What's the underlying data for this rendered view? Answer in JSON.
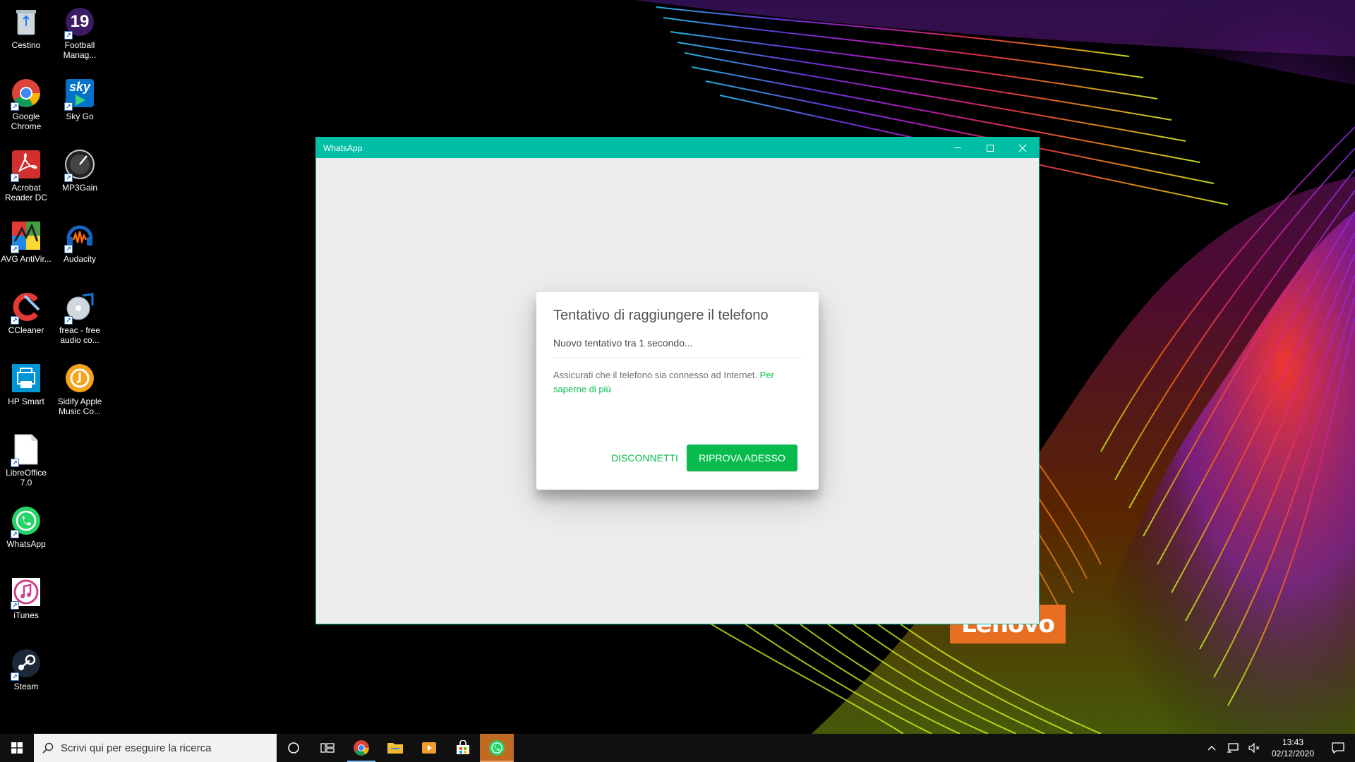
{
  "desktop": {
    "icons": [
      {
        "label": "Cestino",
        "icon": "recycle-bin-icon"
      },
      {
        "label": "Football Manag...",
        "icon": "football-manager-icon",
        "badge": "19"
      },
      {
        "label": "Google Chrome",
        "icon": "chrome-icon"
      },
      {
        "label": "Sky Go",
        "icon": "sky-go-icon",
        "badge": "sky"
      },
      {
        "label": "Acrobat Reader DC",
        "icon": "acrobat-icon"
      },
      {
        "label": "MP3Gain",
        "icon": "mp3gain-icon"
      },
      {
        "label": "AVG AntiVir...",
        "icon": "avg-icon"
      },
      {
        "label": "Audacity",
        "icon": "audacity-icon"
      },
      {
        "label": "CCleaner",
        "icon": "ccleaner-icon"
      },
      {
        "label": "freac - free audio co...",
        "icon": "freac-icon"
      },
      {
        "label": "HP Smart",
        "icon": "hp-smart-icon"
      },
      {
        "label": "Sidify Apple Music Co...",
        "icon": "sidify-icon"
      },
      {
        "label": "LibreOffice 7.0",
        "icon": "libreoffice-icon"
      },
      {
        "label": "WhatsApp",
        "icon": "whatsapp-icon"
      },
      {
        "label": "iTunes",
        "icon": "itunes-icon"
      },
      {
        "label": "Steam",
        "icon": "steam-icon"
      }
    ],
    "wallpaper_brand": "Lenovo"
  },
  "window": {
    "title": "WhatsApp",
    "accent": "#00bfa5",
    "dialog": {
      "title": "Tentativo di raggiungere il telefono",
      "subtitle": "Nuovo tentativo tra 1 secondo...",
      "body": "Assicurati che il telefono sia connesso ad Internet. ",
      "link": "Per saperne di più",
      "disconnect_label": "DISCONNETTI",
      "retry_label": "RIPROVA ADESSO",
      "button_color": "#07bc4c"
    }
  },
  "taskbar": {
    "search_placeholder": "Scrivi qui per eseguire la ricerca",
    "pinned": [
      "cortana-icon",
      "task-view-icon",
      "chrome-icon",
      "file-explorer-icon",
      "media-player-icon",
      "store-icon",
      "whatsapp-icon"
    ],
    "clock_time": "13:43",
    "clock_date": "02/12/2020"
  }
}
